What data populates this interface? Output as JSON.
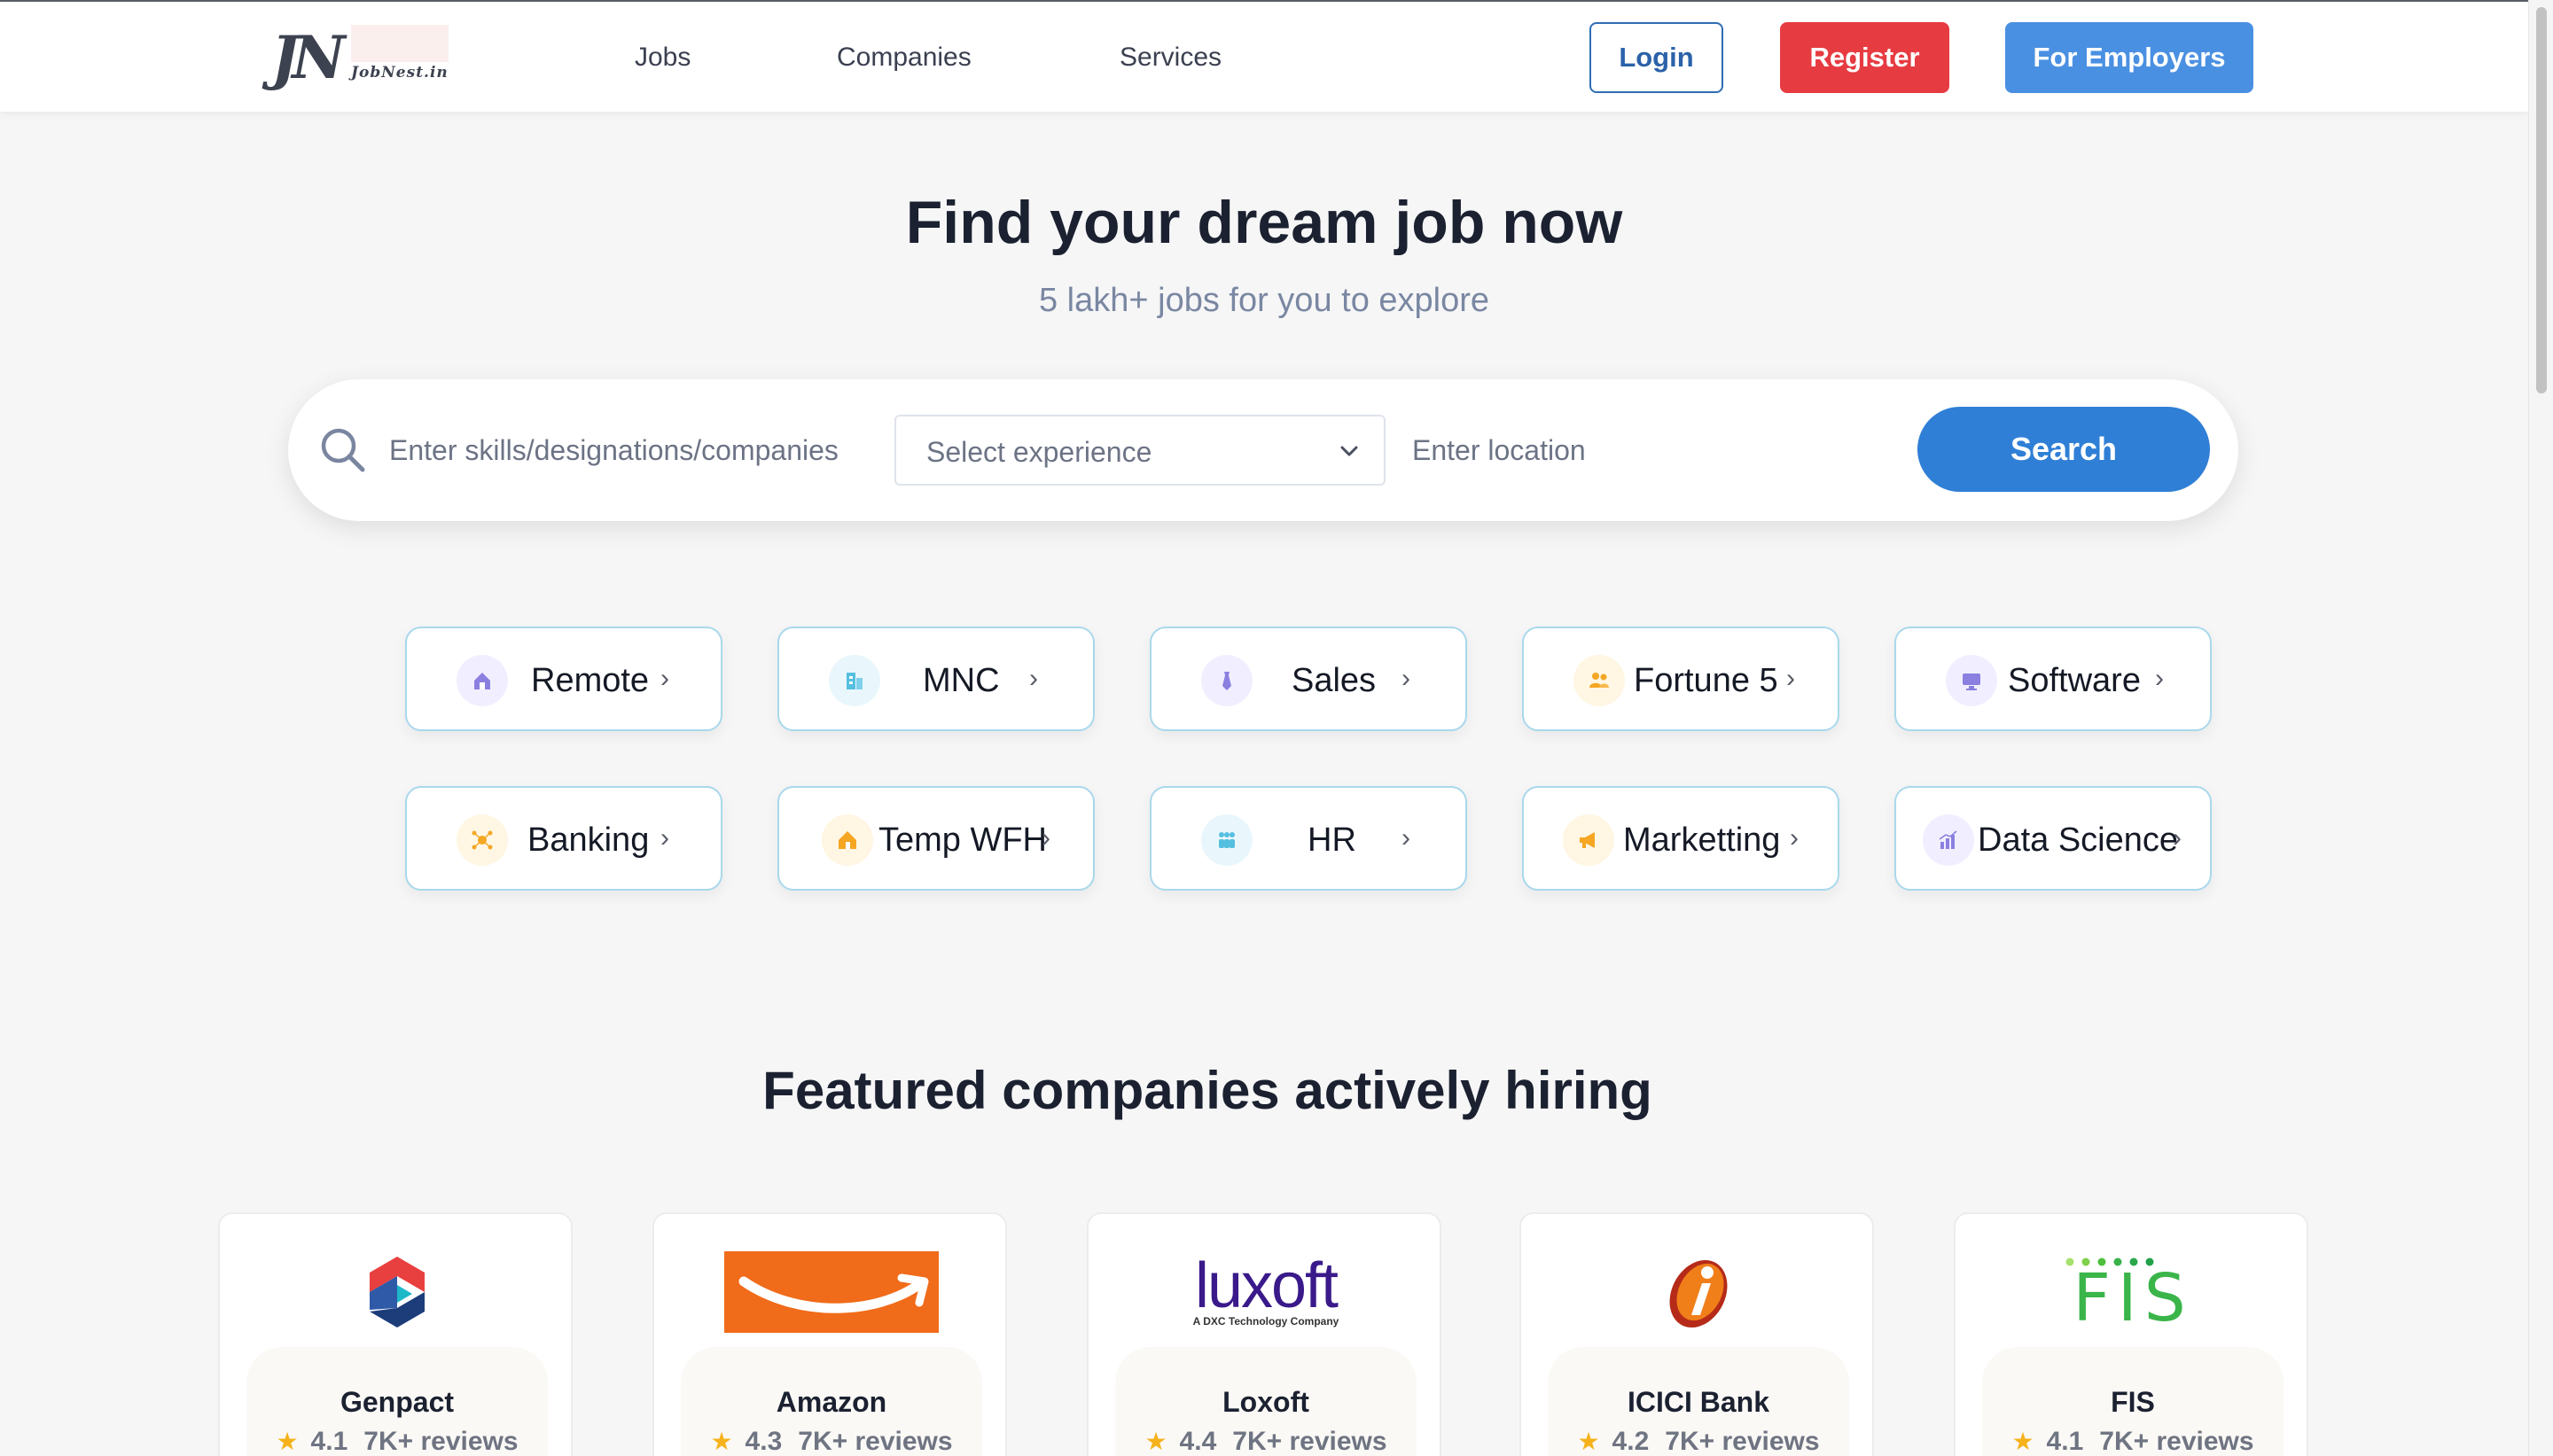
{
  "brand": {
    "logo_text": "JN",
    "logo_subtext": "JobNest.in"
  },
  "nav": {
    "links": [
      "Jobs",
      "Companies",
      "Services"
    ],
    "login": "Login",
    "register": "Register",
    "employers": "For Employers"
  },
  "hero": {
    "title": "Find your dream job now",
    "subtitle": "5 lakh+ jobs for you to explore"
  },
  "search": {
    "skills_placeholder": "Enter skills/designations/companies",
    "experience_placeholder": "Select experience",
    "location_placeholder": "Enter location",
    "button": "Search"
  },
  "categories": [
    {
      "label": "Remote",
      "icon": "house-icon",
      "color": "#8b7fe0"
    },
    {
      "label": "MNC",
      "icon": "building-icon",
      "color": "#55bfe0"
    },
    {
      "label": "Sales",
      "icon": "tie-icon",
      "color": "#8b7fe0"
    },
    {
      "label": "Fortune 5",
      "icon": "people-icon",
      "color": "#f5a623"
    },
    {
      "label": "Software",
      "icon": "monitor-icon",
      "color": "#8b7fe0"
    },
    {
      "label": "Banking",
      "icon": "network-icon",
      "color": "#f5a623"
    },
    {
      "label": "Temp WFH",
      "icon": "home-icon",
      "color": "#f5a623"
    },
    {
      "label": "HR",
      "icon": "team-icon",
      "color": "#55bfe0"
    },
    {
      "label": "Marketting",
      "icon": "megaphone-icon",
      "color": "#f5a623"
    },
    {
      "label": "Data Science",
      "icon": "bar-chart-icon",
      "color": "#8b7fe0"
    }
  ],
  "featured": {
    "title": "Featured companies actively hiring",
    "companies": [
      {
        "name": "Genpact",
        "rating": "4.1",
        "reviews": "7K+ reviews"
      },
      {
        "name": "Amazon",
        "rating": "4.3",
        "reviews": "7K+ reviews"
      },
      {
        "name": "Loxoft",
        "rating": "4.4",
        "reviews": "7K+ reviews",
        "logo_text": "luxoft",
        "logo_subtext": "A DXC Technology Company"
      },
      {
        "name": "ICICI Bank",
        "rating": "4.2",
        "reviews": "7K+ reviews"
      },
      {
        "name": "FIS",
        "rating": "4.1",
        "reviews": "7K+ reviews",
        "logo_text": "FIS"
      }
    ]
  }
}
